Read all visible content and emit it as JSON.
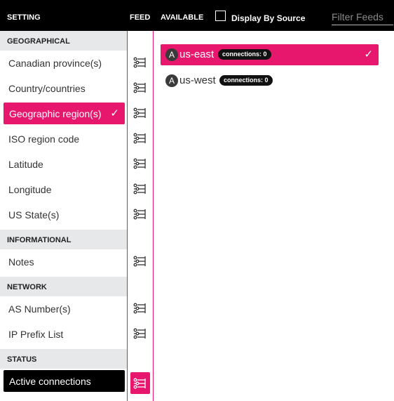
{
  "header": {
    "setting": "SETTING",
    "feed": "FEED",
    "available": "AVAILABLE",
    "display_by_source": "Display By Source",
    "display_by_source_checked": false,
    "filter_placeholder": "Filter Feeds",
    "filter_value": ""
  },
  "sections": {
    "geographical": "GEOGRAPHICAL",
    "informational": "INFORMATIONAL",
    "network": "NETWORK",
    "status": "STATUS"
  },
  "settings": {
    "canadian_provinces": "Canadian province(s)",
    "countries": "Country/countries",
    "geographic_region": "Geographic region(s)",
    "iso_region_code": "ISO region code",
    "latitude": "Latitude",
    "longitude": "Longitude",
    "us_states": "US State(s)",
    "notes": "Notes",
    "as_numbers": "AS Number(s)",
    "ip_prefix_list": "IP Prefix List",
    "active_connections": "Active connections"
  },
  "selected_setting": "Geographic region(s)",
  "check_glyph": "✓",
  "available": [
    {
      "name": "us-east",
      "source_icon": "A",
      "badge_label": "connections:",
      "badge_value": "0",
      "selected": true
    },
    {
      "name": "us-west",
      "source_icon": "A",
      "badge_label": "connections:",
      "badge_value": "0",
      "selected": false
    }
  ],
  "colors": {
    "accent": "#e8176e",
    "header_bg": "#000000",
    "section_bg": "#e7e8ea",
    "text": "#333333"
  },
  "icons": {
    "feed": "filter-sliders-icon",
    "source": "source-a-icon"
  }
}
